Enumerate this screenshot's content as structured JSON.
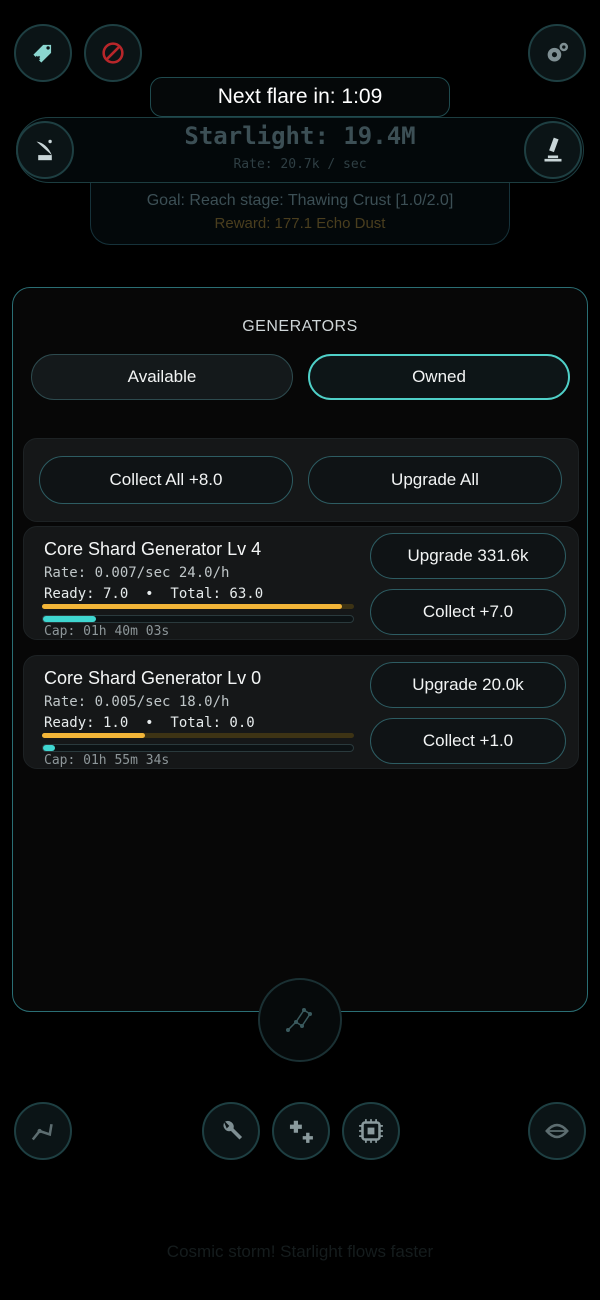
{
  "header": {
    "flare_label": "Next flare in: 1:09",
    "starlight_label": "Starlight: 19.4M",
    "rate_label": "Rate: 20.7k / sec",
    "goal_label": "Goal: Reach stage: Thawing Crust [1.0/2.0]",
    "reward_label": "Reward: 177.1 Echo Dust"
  },
  "icons": {
    "top_left": [
      "tag-icon",
      "forbidden-icon"
    ],
    "top_right": "gears-icon",
    "left": "satellite-dish-icon",
    "right": "microscope-icon",
    "center": "constellation-icon",
    "bottom": [
      "robot-arm-icon",
      "wrench-icon",
      "plus-icon",
      "chip-icon",
      "leaf-icon"
    ]
  },
  "panel": {
    "title": "GENERATORS",
    "tabs": [
      {
        "label": "Available",
        "active": false
      },
      {
        "label": "Owned",
        "active": true
      }
    ],
    "collect_all_label": "Collect All +8.0",
    "upgrade_all_label": "Upgrade All",
    "generators": [
      {
        "name": "Core Shard Generator  Lv 4",
        "rate": "Rate: 0.007/sec 24.0/h",
        "ready": "Ready: 7.0  •  Total: 63.0",
        "ready_fraction": 0.96,
        "cap_fraction": 0.17,
        "cap": "Cap: 01h 40m 03s",
        "upgrade_label": "Upgrade 331.6k",
        "collect_label": "Collect +7.0"
      },
      {
        "name": "Core Shard Generator  Lv 0",
        "rate": "Rate: 0.005/sec 18.0/h",
        "ready": "Ready: 1.0  •  Total: 0.0",
        "ready_fraction": 0.33,
        "cap_fraction": 0.04,
        "cap": "Cap: 01h 55m 34s",
        "upgrade_label": "Upgrade 20.0k",
        "collect_label": "Collect +1.0"
      }
    ]
  },
  "footer": {
    "hint": "Cosmic storm! Starlight flows faster"
  },
  "colors": {
    "accent": "#4fd0c8",
    "ready_bar": "#f2b538",
    "cap_bar": "#3fd6d0"
  }
}
